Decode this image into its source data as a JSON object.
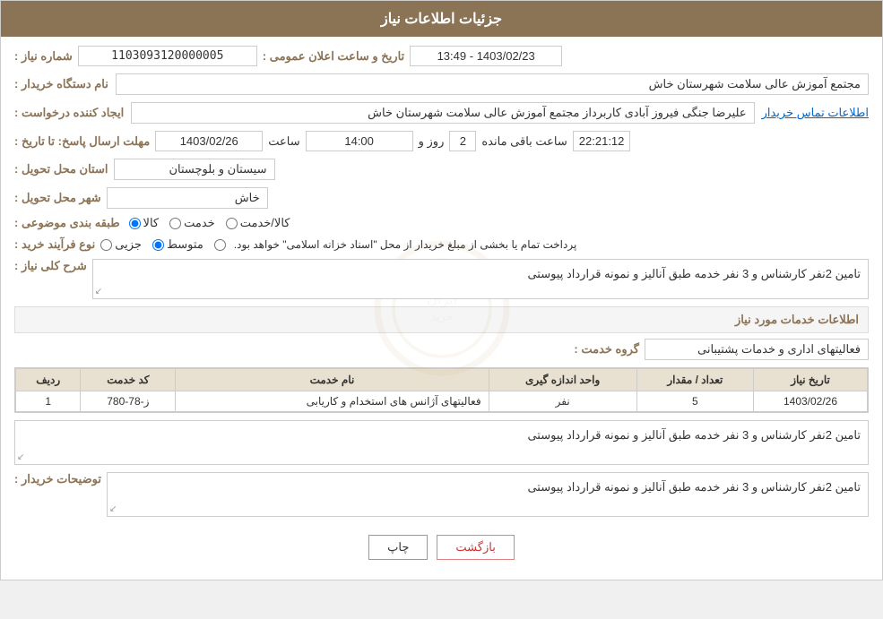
{
  "page": {
    "title": "جزئیات اطلاعات نیاز",
    "sections": {
      "header": {
        "shomara_label": "شماره نیاز :",
        "shomara_value": "1103093120000005",
        "tarikh_label": "تاریخ و ساعت اعلان عمومی :",
        "tarikh_value": "1403/02/23 - 13:49",
        "nam_dastgah_label": "نام دستگاه خریدار :",
        "nam_dastgah_value": "مجتمع آموزش عالی سلامت شهرستان خاش",
        "ijad_label": "ایجاد کننده درخواست :",
        "ijad_value": "علیرضا جنگی فیروز آبادی کاربرداز مجتمع آموزش عالی سلامت شهرستان خاش",
        "contact_link": "اطلاعات تماس خریدار",
        "mohlat_label": "مهلت ارسال پاسخ: تا تاریخ :",
        "mohlat_date": "1403/02/26",
        "mohlat_saat_label": "ساعت",
        "mohlat_saat": "14:00",
        "mohlat_roz_label": "روز و",
        "mohlat_roz": "2",
        "mohlat_baqi_label": "ساعت باقی مانده",
        "mohlat_baqi": "22:21:12",
        "ostan_label": "استان محل تحویل :",
        "ostan_value": "سیستان و بلوچستان",
        "shahr_label": "شهر محل تحویل :",
        "shahr_value": "خاش",
        "tabagheh_label": "طبقه بندی موضوعی :",
        "tabagheh_options": [
          {
            "label": "کالا",
            "selected": true
          },
          {
            "label": "خدمت",
            "selected": false
          },
          {
            "label": "کالا/خدمت",
            "selected": false
          }
        ],
        "noع_farayand_label": "نوع فرآیند خرید :",
        "noع_farayand_options": [
          {
            "label": "جزیی",
            "selected": false
          },
          {
            "label": "متوسط",
            "selected": true
          },
          {
            "label": "",
            "selected": false
          }
        ],
        "noع_farayand_note": "پرداخت تمام یا بخشی از مبلغ خریدار از محل \"اسناد خزانه اسلامی\" خواهد بود."
      },
      "sharh": {
        "title": "شرح کلی نیاز :",
        "value": "تامین 2نفر کارشناس و 3 نفر خدمه طبق آنالیز و نمونه قرارداد پیوستی"
      },
      "khadamat": {
        "title": "اطلاعات خدمات مورد نیاز",
        "grouh_label": "گروه خدمت :",
        "grouh_value": "فعالیتهای اداری و خدمات پشتیبانی",
        "table": {
          "headers": [
            "ردیف",
            "کد خدمت",
            "نام خدمت",
            "واحد اندازه گیری",
            "تعداد / مقدار",
            "تاریخ نیاز"
          ],
          "rows": [
            {
              "radif": "1",
              "kod": "ز-78-780",
              "name": "فعالیتهای آژانس های استخدام و کاریابی",
              "vahed": "نفر",
              "tedad": "5",
              "tarikh": "1403/02/26"
            }
          ]
        },
        "description": "تامین 2نفر کارشناس و 3 نفر خدمه طبق آنالیز و نمونه قرارداد پیوستی"
      },
      "tawzihat": {
        "label": "توضیحات خریدار :",
        "value": "تامین 2نفر کارشناس و 3 نفر خدمه طبق آنالیز و نمونه قرارداد پیوستی"
      }
    },
    "buttons": {
      "print_label": "چاپ",
      "back_label": "بازگشت"
    }
  }
}
